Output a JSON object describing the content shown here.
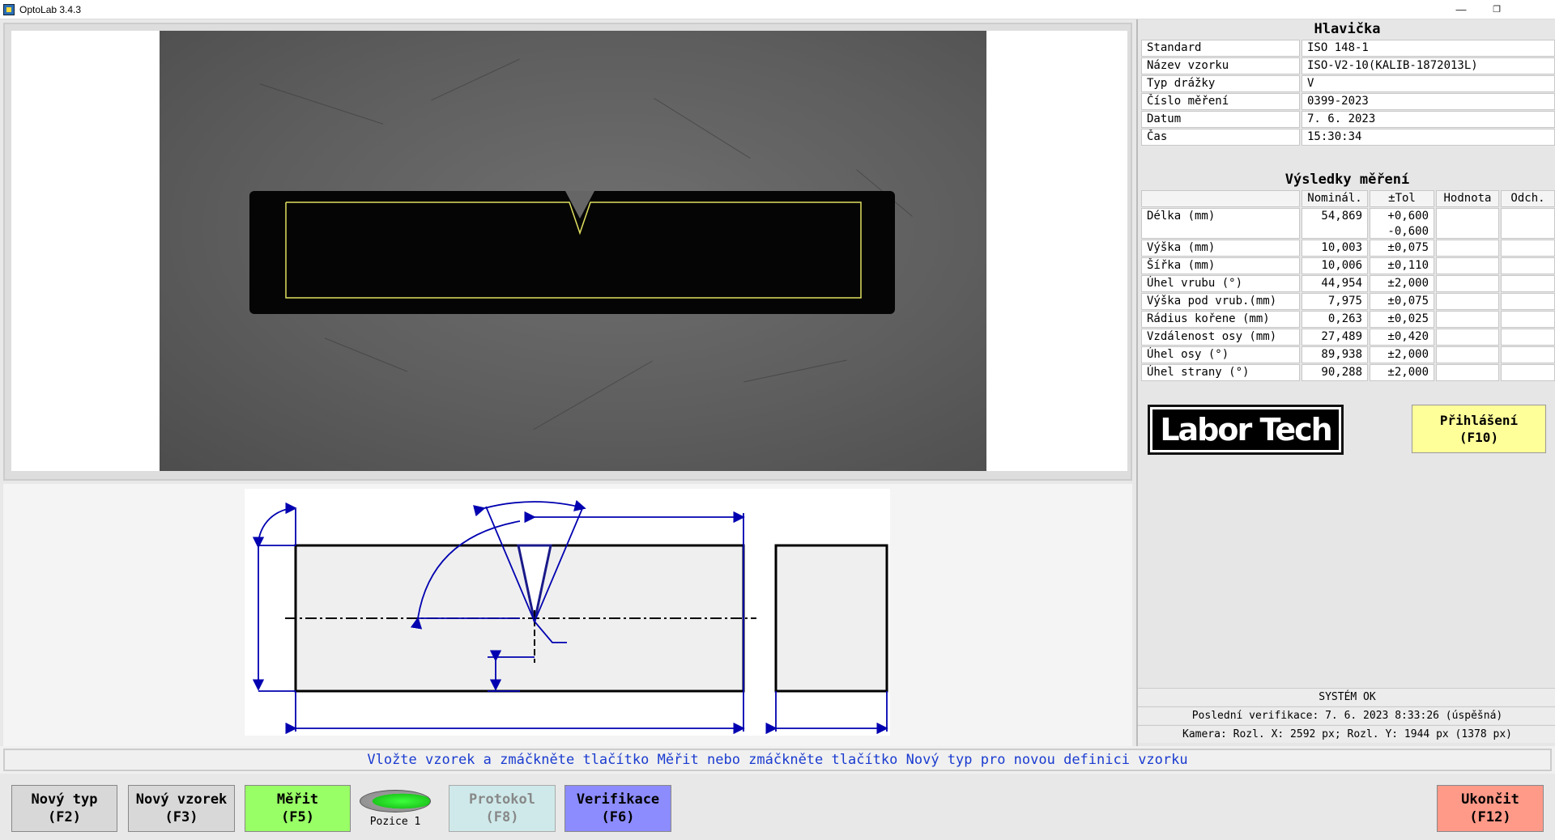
{
  "window": {
    "title": "OptoLab 3.4.3",
    "minimize_glyph": "—",
    "restore_glyph": "❐"
  },
  "header": {
    "title": "Hlavička",
    "rows": [
      {
        "label": "Standard",
        "value": "ISO 148-1"
      },
      {
        "label": "Název vzorku",
        "value": "ISO-V2-10(KALIB-1872013L)"
      },
      {
        "label": "Typ drážky",
        "value": "V"
      },
      {
        "label": "Číslo měření",
        "value": "0399-2023"
      },
      {
        "label": "Datum",
        "value": "7. 6. 2023"
      },
      {
        "label": "Čas",
        "value": "15:30:34"
      }
    ]
  },
  "results": {
    "title": "Výsledky měření",
    "columns": [
      "Nominál.",
      "±Tol",
      "Hodnota",
      "Odch."
    ],
    "rows": [
      {
        "name": "Délka (mm)",
        "nominal": "54,869",
        "tol": "+0,600",
        "tol2": "-0,600",
        "value": "",
        "dev": ""
      },
      {
        "name": "Výška (mm)",
        "nominal": "10,003",
        "tol": "±0,075",
        "value": "",
        "dev": ""
      },
      {
        "name": "Šířka (mm)",
        "nominal": "10,006",
        "tol": "±0,110",
        "value": "",
        "dev": ""
      },
      {
        "name": "Úhel vrubu (°)",
        "nominal": "44,954",
        "tol": "±2,000",
        "value": "",
        "dev": ""
      },
      {
        "name": "Výška pod vrub.(mm)",
        "nominal": "7,975",
        "tol": "±0,075",
        "value": "",
        "dev": ""
      },
      {
        "name": "Rádius kořene (mm)",
        "nominal": "0,263",
        "tol": "±0,025",
        "value": "",
        "dev": ""
      },
      {
        "name": "Vzdálenost osy (mm)",
        "nominal": "27,489",
        "tol": "±0,420",
        "value": "",
        "dev": ""
      },
      {
        "name": "Úhel osy (°)",
        "nominal": "89,938",
        "tol": "±2,000",
        "value": "",
        "dev": ""
      },
      {
        "name": "Úhel strany (°)",
        "nominal": "90,288",
        "tol": "±2,000",
        "value": "",
        "dev": ""
      }
    ]
  },
  "logo": {
    "text": "Labor Tech"
  },
  "login": {
    "line1": "Přihlášení",
    "line2": "(F10)"
  },
  "status": {
    "system": "SYSTÉM OK",
    "verification": "Poslední verifikace: 7. 6. 2023 8:33:26 (úspěšná)",
    "camera": "Kamera: Rozl. X: 2592 px; Rozl. Y: 1944 px (1378 px)"
  },
  "message": "Vložte vzorek a zmáčkněte tlačítko Měřit nebo zmáčkněte tlačítko Nový typ pro novou definici vzorku",
  "buttons": {
    "new_type": {
      "line1": "Nový typ",
      "line2": "(F2)"
    },
    "new_sample": {
      "line1": "Nový vzorek",
      "line2": "(F3)"
    },
    "measure": {
      "line1": "Měřit",
      "line2": "(F5)"
    },
    "position": {
      "label": "Pozice 1"
    },
    "protocol": {
      "line1": "Protokol",
      "line2": "(F8)"
    },
    "verification": {
      "line1": "Verifikace",
      "line2": "(F6)"
    },
    "exit": {
      "line1": "Ukončit",
      "line2": "(F12)"
    }
  },
  "colors": {
    "measure_btn": "#99ff66",
    "protocol_btn": "#cfe9ea",
    "verify_btn": "#8c8cff",
    "exit_btn": "#ff9988",
    "login_btn": "#ffff99",
    "message_text": "#1a3bd0",
    "drawing_blue": "#0000b0"
  }
}
